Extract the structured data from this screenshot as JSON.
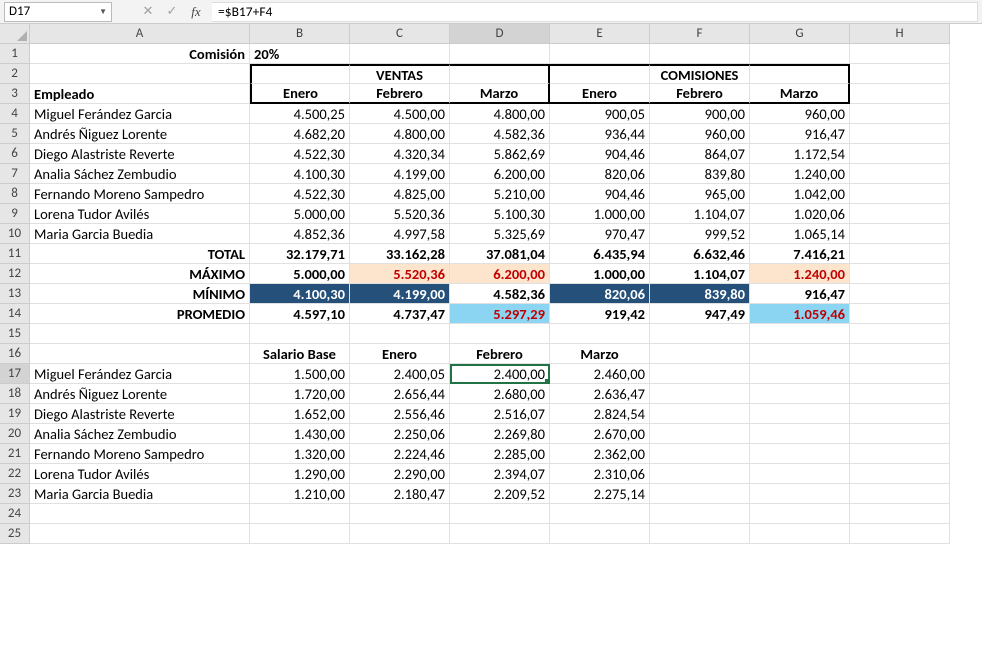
{
  "name_box": "D17",
  "formula": "=$B17+F4",
  "columns": [
    "A",
    "B",
    "C",
    "D",
    "E",
    "F",
    "G",
    "H"
  ],
  "row_count": 25,
  "active": {
    "col": "D",
    "row": 17
  },
  "r1": {
    "comision_lbl": "Comisión",
    "comision_val": "20%"
  },
  "r2": {
    "ventas": "VENTAS",
    "comisiones": "COMISIONES"
  },
  "r3": {
    "empleado": "Empleado",
    "enero": "Enero",
    "febrero": "Febrero",
    "marzo": "Marzo",
    "enero2": "Enero",
    "febrero2": "Febrero",
    "marzo2": "Marzo"
  },
  "emp": [
    {
      "n": "Miguel Ferández Garcia",
      "b": "4.500,25",
      "c": "4.500,00",
      "d": "4.800,00",
      "e": "900,05",
      "f": "900,00",
      "g": "960,00"
    },
    {
      "n": "Andrés Ñiguez Lorente",
      "b": "4.682,20",
      "c": "4.800,00",
      "d": "4.582,36",
      "e": "936,44",
      "f": "960,00",
      "g": "916,47"
    },
    {
      "n": "Diego Alastriste Reverte",
      "b": "4.522,30",
      "c": "4.320,34",
      "d": "5.862,69",
      "e": "904,46",
      "f": "864,07",
      "g": "1.172,54"
    },
    {
      "n": "Analia Sáchez Zembudio",
      "b": "4.100,30",
      "c": "4.199,00",
      "d": "6.200,00",
      "e": "820,06",
      "f": "839,80",
      "g": "1.240,00"
    },
    {
      "n": "Fernando Moreno Sampedro",
      "b": "4.522,30",
      "c": "4.825,00",
      "d": "5.210,00",
      "e": "904,46",
      "f": "965,00",
      "g": "1.042,00"
    },
    {
      "n": "Lorena Tudor Avilés",
      "b": "5.000,00",
      "c": "5.520,36",
      "d": "5.100,30",
      "e": "1.000,00",
      "f": "1.104,07",
      "g": "1.020,06"
    },
    {
      "n": "Maria Garcia Buedia",
      "b": "4.852,36",
      "c": "4.997,58",
      "d": "5.325,69",
      "e": "970,47",
      "f": "999,52",
      "g": "1.065,14"
    }
  ],
  "total": {
    "lbl": "TOTAL",
    "b": "32.179,71",
    "c": "33.162,28",
    "d": "37.081,04",
    "e": "6.435,94",
    "f": "6.632,46",
    "g": "7.416,21"
  },
  "maximo": {
    "lbl": "MÁXIMO",
    "b": "5.000,00",
    "c": "5.520,36",
    "d": "6.200,00",
    "e": "1.000,00",
    "f": "1.104,07",
    "g": "1.240,00"
  },
  "minimo": {
    "lbl": "MÍNIMO",
    "b": "4.100,30",
    "c": "4.199,00",
    "d": "4.582,36",
    "e": "820,06",
    "f": "839,80",
    "g": "916,47"
  },
  "promedio": {
    "lbl": "PROMEDIO",
    "b": "4.597,10",
    "c": "4.737,47",
    "d": "5.297,29",
    "e": "919,42",
    "f": "947,49",
    "g": "1.059,46"
  },
  "r16": {
    "b": "Salario Base",
    "c": "Enero",
    "d": "Febrero",
    "e": "Marzo"
  },
  "sal": [
    {
      "n": "Miguel Ferández Garcia",
      "b": "1.500,00",
      "c": "2.400,05",
      "d": "2.400,00",
      "e": "2.460,00"
    },
    {
      "n": "Andrés Ñiguez Lorente",
      "b": "1.720,00",
      "c": "2.656,44",
      "d": "2.680,00",
      "e": "2.636,47"
    },
    {
      "n": "Diego Alastriste Reverte",
      "b": "1.652,00",
      "c": "2.556,46",
      "d": "2.516,07",
      "e": "2.824,54"
    },
    {
      "n": "Analia Sáchez Zembudio",
      "b": "1.430,00",
      "c": "2.250,06",
      "d": "2.269,80",
      "e": "2.670,00"
    },
    {
      "n": "Fernando Moreno Sampedro",
      "b": "1.320,00",
      "c": "2.224,46",
      "d": "2.285,00",
      "e": "2.362,00"
    },
    {
      "n": "Lorena Tudor Avilés",
      "b": "1.290,00",
      "c": "2.290,00",
      "d": "2.394,07",
      "e": "2.310,06"
    },
    {
      "n": "Maria Garcia Buedia",
      "b": "1.210,00",
      "c": "2.180,47",
      "d": "2.209,52",
      "e": "2.275,14"
    }
  ]
}
